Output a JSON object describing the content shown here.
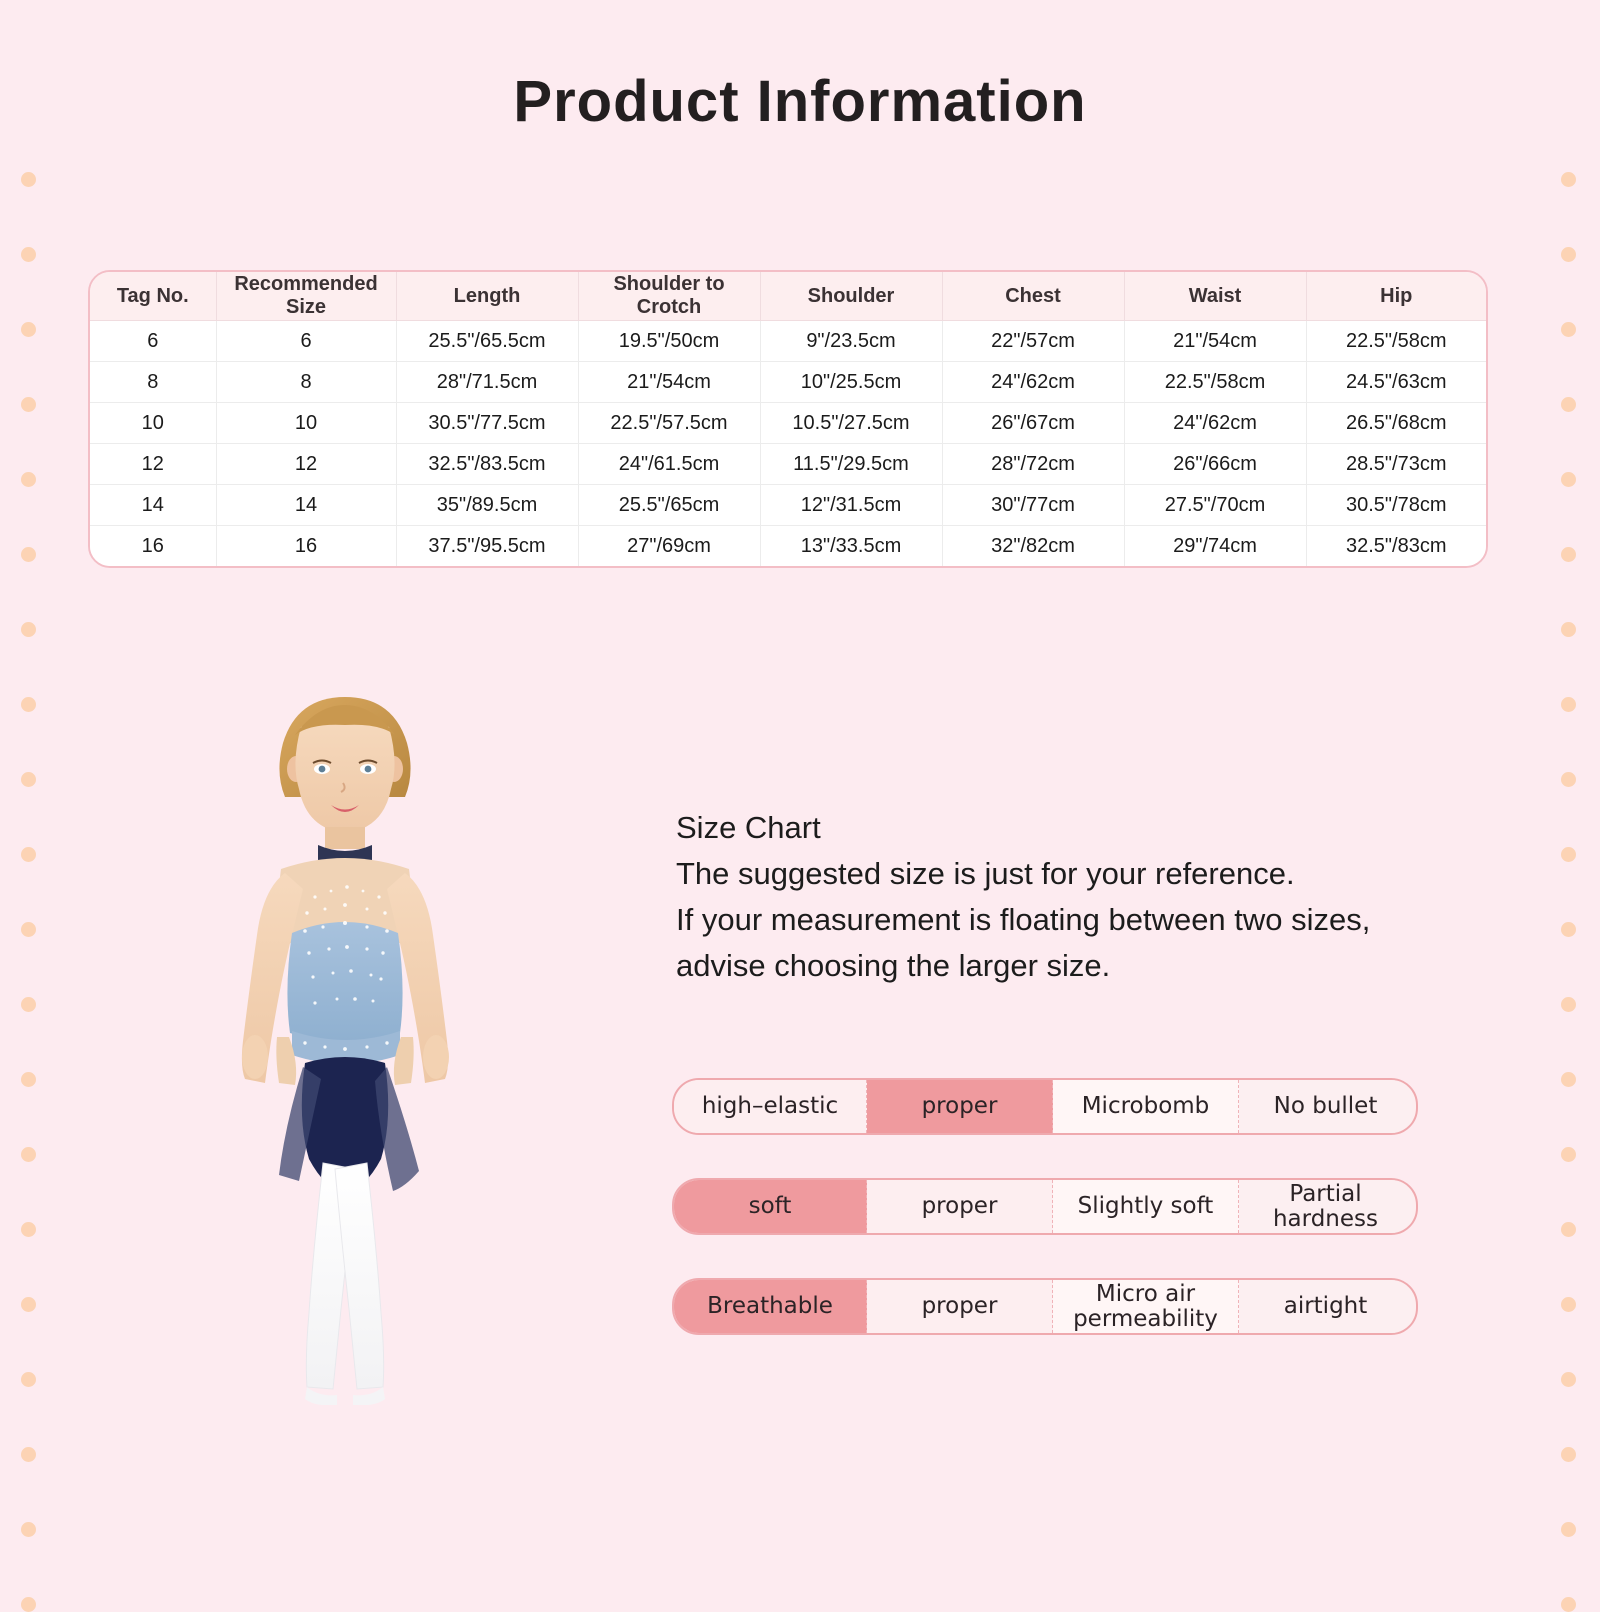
{
  "header": {
    "title": "Product  Information"
  },
  "theme": {
    "background": "#fdebf0",
    "dot_color": "#fcd2b0",
    "table_border": "#f3bec6",
    "table_header_bg": "#fdeeef",
    "bar_border": "#efa9ae",
    "bar_bg": "#fdeef0",
    "highlight": "#ef9a9e",
    "text": "#1c1c1c"
  },
  "size_table": {
    "columns": [
      "Tag No.",
      "Recommended Size",
      "Length",
      "Shoulder to Crotch",
      "Shoulder",
      "Chest",
      "Waist",
      "Hip"
    ],
    "rows": [
      [
        "6",
        "6",
        "25.5\"/65.5cm",
        "19.5\"/50cm",
        "9\"/23.5cm",
        "22\"/57cm",
        "21\"/54cm",
        "22.5\"/58cm"
      ],
      [
        "8",
        "8",
        "28\"/71.5cm",
        "21\"/54cm",
        "10\"/25.5cm",
        "24\"/62cm",
        "22.5\"/58cm",
        "24.5\"/63cm"
      ],
      [
        "10",
        "10",
        "30.5\"/77.5cm",
        "22.5\"/57.5cm",
        "10.5\"/27.5cm",
        "26\"/67cm",
        "24\"/62cm",
        "26.5\"/68cm"
      ],
      [
        "12",
        "12",
        "32.5\"/83.5cm",
        "24\"/61.5cm",
        "11.5\"/29.5cm",
        "28\"/72cm",
        "26\"/66cm",
        "28.5\"/73cm"
      ],
      [
        "14",
        "14",
        "35\"/89.5cm",
        "25.5\"/65cm",
        "12\"/31.5cm",
        "30\"/77cm",
        "27.5\"/70cm",
        "30.5\"/78cm"
      ],
      [
        "16",
        "16",
        "37.5\"/95.5cm",
        "27\"/69cm",
        "13\"/33.5cm",
        "32\"/82cm",
        "29\"/74cm",
        "32.5\"/83cm"
      ]
    ]
  },
  "size_chart_note": {
    "heading": "Size Chart",
    "line1": "The suggested size is just for your reference.",
    "line2": "If your measurement is floating between two sizes,",
    "line3": "advise choosing the larger size."
  },
  "property_bars": [
    {
      "name": "elasticity",
      "segments": [
        "high–elastic",
        "proper",
        "Microbomb",
        "No bullet"
      ],
      "selected_index": 1
    },
    {
      "name": "softness",
      "segments": [
        "soft",
        "proper",
        "Slightly soft",
        "Partial hardness"
      ],
      "selected_index": 0
    },
    {
      "name": "breathability",
      "segments": [
        "Breathable",
        "proper",
        "Micro air permeability",
        "airtight"
      ],
      "selected_index": 0
    }
  ],
  "model_photo": {
    "alt": "girl wearing blue sequin figure skating dress with white tights"
  },
  "icons": {
    "dot": "decorative-dot"
  }
}
